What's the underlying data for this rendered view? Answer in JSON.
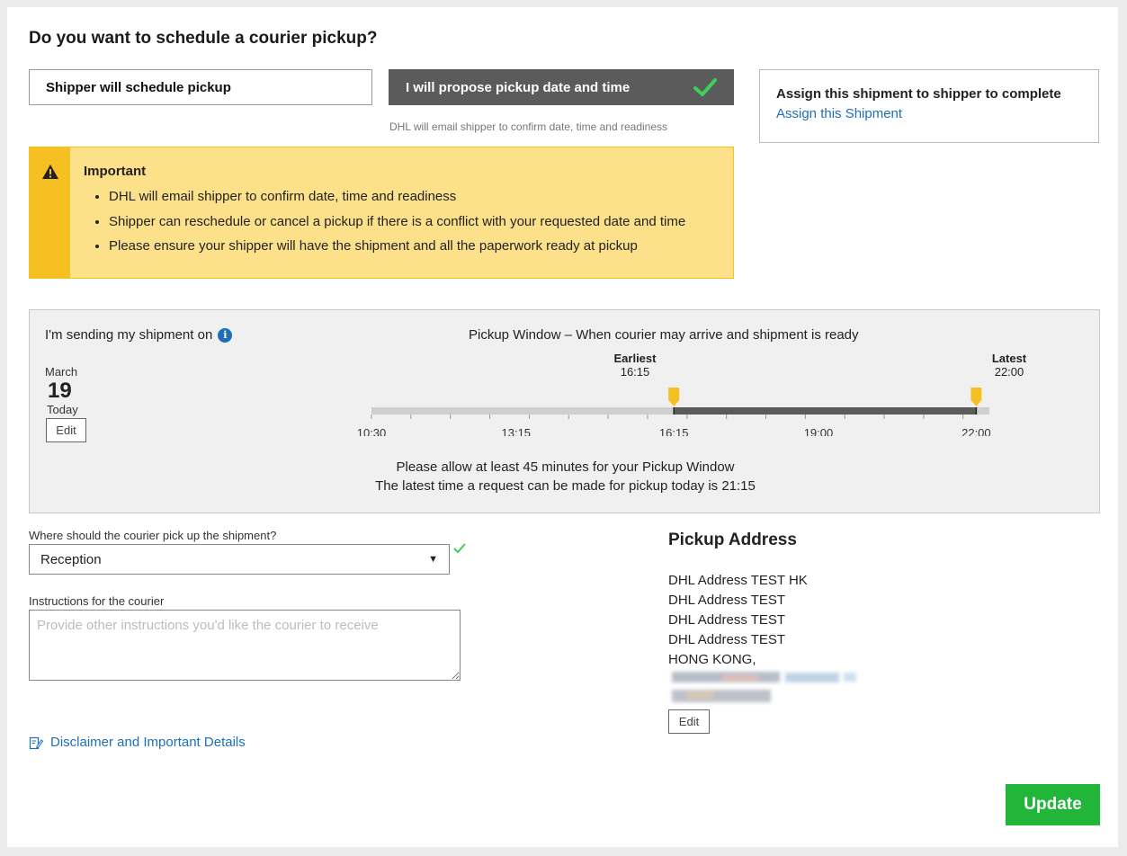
{
  "page": {
    "title": "Do you want to schedule a courier pickup?"
  },
  "options": {
    "shipper_schedule": "Shipper will schedule pickup",
    "propose": "I will propose pickup date and time",
    "propose_selected": true,
    "hint": "DHL will email shipper to confirm date, time and readiness"
  },
  "assign": {
    "title": "Assign this shipment to shipper to complete",
    "link": "Assign this Shipment"
  },
  "important": {
    "title": "Important",
    "items": [
      "DHL will email shipper to confirm date, time and readiness",
      "Shipper can reschedule or cancel a pickup if there is a conflict with your requested date and time",
      "Please ensure your shipper will have the shipment and all the paperwork ready at pickup"
    ]
  },
  "pickup_window": {
    "sending_label": "I'm sending my shipment on",
    "date": {
      "month": "March",
      "day": "19",
      "relative": "Today",
      "edit": "Edit"
    },
    "title": "Pickup Window – When courier may arrive and shipment is ready",
    "earliest": {
      "label": "Earliest",
      "time": "16:15"
    },
    "latest": {
      "label": "Latest",
      "time": "22:00"
    },
    "timeline": {
      "start": "10:30",
      "end": "22:15",
      "earliest": "16:15",
      "latest": "22:00",
      "tick_labels": [
        "10:30",
        "13:15",
        "16:15",
        "19:00",
        "22:00"
      ]
    },
    "note1": "Please allow at least 45 minutes for your Pickup Window",
    "note2": "The latest time a request can be made for pickup today is 21:15"
  },
  "pickup_location": {
    "label": "Where should the courier pick up the shipment?",
    "value": "Reception"
  },
  "instructions": {
    "label": "Instructions for the courier",
    "placeholder": "Provide other instructions you'd like the courier to receive"
  },
  "disclaimer": "Disclaimer and Important Details",
  "pickup_address": {
    "title": "Pickup Address",
    "lines": [
      "DHL Address TEST HK",
      "DHL Address TEST",
      "DHL Address TEST",
      "DHL Address TEST",
      "HONG KONG,"
    ],
    "edit": "Edit"
  },
  "update_button": "Update",
  "colors": {
    "accent_blue": "#1d6fb8",
    "warning_yellow": "#fde08a",
    "warning_strip": "#f6c023",
    "selected_dark": "#5b5b5b",
    "success_green": "#21b53a",
    "marker": "#f6c023"
  }
}
